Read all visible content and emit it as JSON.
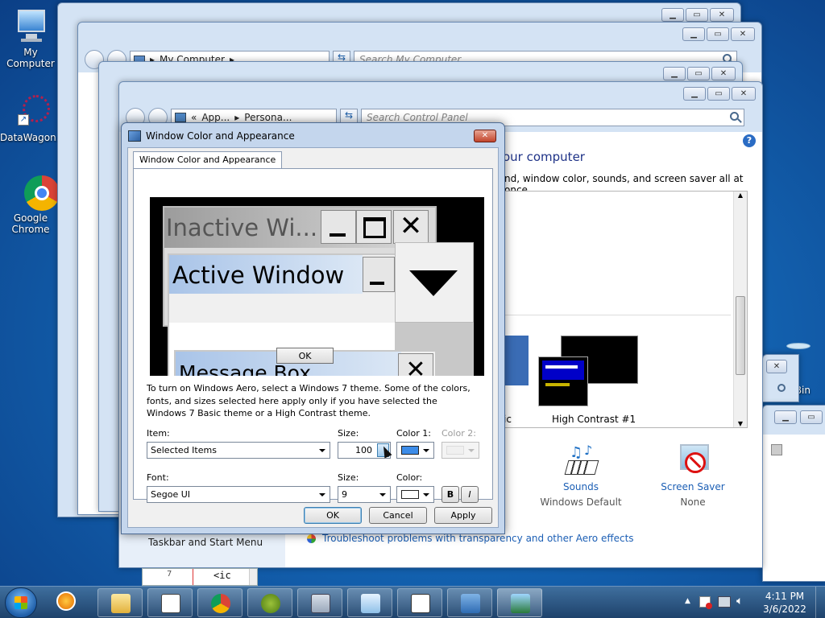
{
  "desktop": {
    "icons": [
      {
        "label": "My Computer"
      },
      {
        "label": "DataWagon..."
      },
      {
        "label": "Google Chrome"
      },
      {
        "label": "Bin"
      }
    ]
  },
  "explorer": {
    "address": "My Computer",
    "search_placeholder": "Search My Computer"
  },
  "control_panel": {
    "address_parts": [
      "App...",
      "Persona..."
    ],
    "search_placeholder": "Search Control Panel",
    "heading_partial": "our computer",
    "desc_partial": "nd, window color, sounds, and screen saver all at once.",
    "theme_partial_label": "ic",
    "high_contrast_label": "High Contrast #1",
    "sounds_label": "Sounds",
    "sounds_value": "Windows Default",
    "screensaver_label": "Screen Saver",
    "screensaver_value": "None",
    "taskbar_link": "Taskbar and Start Menu",
    "troubleshoot_link": "Troubleshoot problems with transparency and other Aero effects"
  },
  "dialog": {
    "title": "Window Color and Appearance",
    "tab": "Window Color and Appearance",
    "preview": {
      "inactive": "Inactive Wi...",
      "active": "Active Window",
      "message_box": "Message Box",
      "ok": "OK"
    },
    "info_text": "To turn on Windows Aero, select a Windows 7 theme.  Some of the colors, fonts, and sizes selected here apply only if you have selected the Windows 7 Basic theme or a High Contrast theme.",
    "item_label": "Item:",
    "item_value": "Selected Items",
    "size_label": "Size:",
    "size_value": "100",
    "color1_label": "Color 1:",
    "color2_label": "Color 2:",
    "font_label": "Font:",
    "font_value": "Segoe UI",
    "font_size_label": "Size:",
    "font_size_value": "9",
    "font_color_label": "Color:",
    "bold_label": "B",
    "italic_label": "I",
    "ok": "OK",
    "cancel": "Cancel",
    "apply": "Apply",
    "colors": {
      "color1": "#3c8ce8",
      "font_color": "#ffffff"
    }
  },
  "taskbar": {
    "time": "4:11 PM",
    "date": "3/6/2022",
    "code_line_number": "7",
    "code_text": "<ic"
  }
}
